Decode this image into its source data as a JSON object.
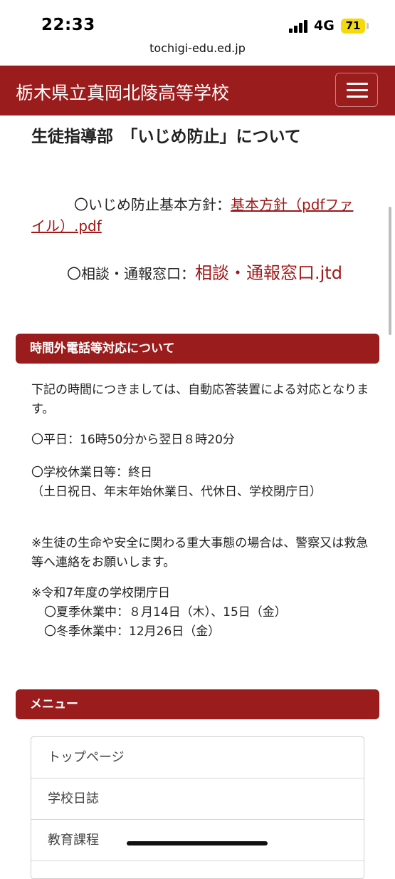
{
  "status_bar": {
    "time": "22:33",
    "network": "4G",
    "battery": "71"
  },
  "browser": {
    "url": "tochigi-edu.ed.jp"
  },
  "header": {
    "site_title": "栃木県立真岡北陵高等学校"
  },
  "bullying": {
    "title": "生徒指導部　「いじめ防止」について",
    "policy_label": "〇いじめ防止基本方針：",
    "policy_link": "基本方針（pdfファイル）.pdf",
    "consult_label": "〇相談・通報窓口：",
    "consult_link": "相談・通報窓口.jtd"
  },
  "after_hours": {
    "heading": "時間外電話等対応について",
    "intro": "下記の時間につきましては、自動応答装置による対応となります。",
    "weekday": "〇平日：16時50分から翌日８時20分",
    "holiday": "〇学校休業日等：終日",
    "holiday_note": "（土日祝日、年末年始休業日、代休日、学校閉庁日）",
    "emergency": "※生徒の生命や安全に関わる重大事態の場合は、警察又は救急等へ連絡をお願いします。",
    "closure_title": "※令和7年度の学校閉庁日",
    "summer": "〇夏季休業中：８月14日（木）、15日（金）",
    "winter": "〇冬季休業中：12月26日（金）"
  },
  "menu": {
    "heading": "メニュー",
    "items": [
      "トップページ",
      "学校日誌",
      "教育課程"
    ]
  },
  "colors": {
    "brand": "#9b1c1c",
    "link": "#a01818",
    "battery": "#f5d90a"
  }
}
